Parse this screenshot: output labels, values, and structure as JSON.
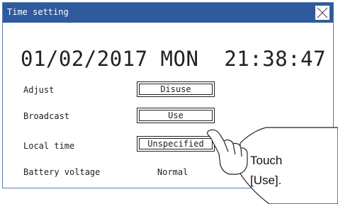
{
  "window": {
    "title": "Time setting"
  },
  "datetime": {
    "display": "01/02/2017 MON  21:38:47"
  },
  "settings": {
    "adjust": {
      "label": "Adjust",
      "value": "Disuse"
    },
    "broadcast": {
      "label": "Broadcast",
      "value": "Use"
    },
    "local_time": {
      "label": "Local time",
      "value": "Unspecified"
    },
    "battery_voltage": {
      "label": "Battery voltage",
      "value": "Normal"
    }
  },
  "callout": {
    "line1": "Touch",
    "line2": "[Use]."
  },
  "icons": {
    "close": "close-icon",
    "hand": "pointing-hand-icon"
  },
  "colors": {
    "titlebar": "#2f5a9e",
    "title_text": "#ffffff",
    "text": "#222222"
  }
}
